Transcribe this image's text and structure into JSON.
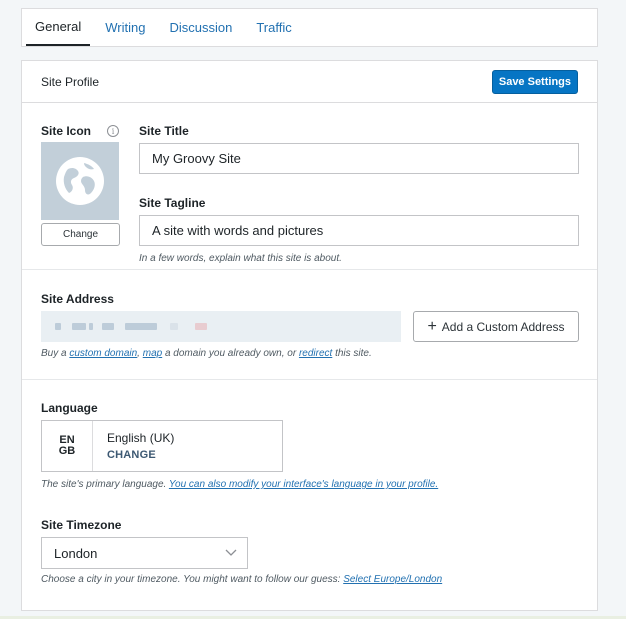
{
  "tabs": [
    {
      "label": "General",
      "active": true
    },
    {
      "label": "Writing",
      "active": false
    },
    {
      "label": "Discussion",
      "active": false
    },
    {
      "label": "Traffic",
      "active": false
    }
  ],
  "site_profile": {
    "title": "Site Profile",
    "save_label": "Save Settings"
  },
  "site_icon": {
    "label": "Site Icon",
    "info_glyph": "i",
    "change_label": "Change"
  },
  "site_title": {
    "label": "Site Title",
    "value": "My Groovy Site"
  },
  "site_tagline": {
    "label": "Site Tagline",
    "value": "A site with words and pictures",
    "help": "In a few words, explain what this site is about."
  },
  "site_address": {
    "label": "Site Address",
    "add_custom_label": "Add a Custom Address",
    "help_prefix": "Buy a ",
    "help_link1": "custom domain",
    "help_sep": ", ",
    "help_link2": "map",
    "help_mid": " a domain you already own, or ",
    "help_link3": "redirect",
    "help_suffix": " this site."
  },
  "language": {
    "label": "Language",
    "code_line1": "EN",
    "code_line2": "GB",
    "name": "English (UK)",
    "change_label": "CHANGE",
    "help_text": "The site's primary language. ",
    "help_link": "You can also modify your interface's language in your profile."
  },
  "timezone": {
    "label": "Site Timezone",
    "selected": "London",
    "help_text": "Choose a city in your timezone. You might want to follow our guess: ",
    "help_link": "Select Europe/London"
  },
  "colors": {
    "accent": "#2271b1",
    "primary_button": "#0675c4",
    "icon_background": "#c2cfd9"
  }
}
